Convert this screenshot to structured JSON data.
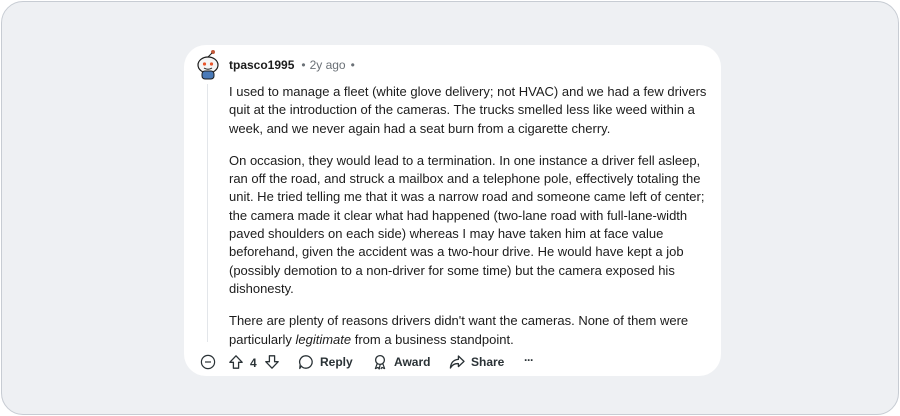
{
  "comment": {
    "username": "tpasco1995",
    "separator": "•",
    "age": "2y ago",
    "separator_end": "•",
    "paragraphs": [
      "I used to manage a fleet (white glove delivery; not HVAC) and we had a few drivers quit at the introduction of the cameras. The trucks smelled less like weed within a week, and we never again had a seat burn from a cigarette cherry.",
      "On occasion, they would lead to a termination. In one instance a driver fell asleep, ran off the road, and struck a mailbox and a telephone pole, effectively totaling the unit. He tried telling me that it was a narrow road and someone came left of center; the camera made it clear what had happened (two-lane road with full-lane-width paved shoulders on each side) whereas I may have taken him at face value beforehand, given the accident was a two-hour drive. He would have kept a job (possibly demotion to a non-driver for some time) but the camera exposed his dishonesty."
    ],
    "last_paragraph": {
      "before": "There are plenty of reasons drivers didn't want the cameras. None of them were particularly ",
      "emphasis": "legitimate",
      "after": " from a business standpoint."
    }
  },
  "actions": {
    "score": "4",
    "reply_label": "Reply",
    "award_label": "Award",
    "share_label": "Share",
    "more_label": "···"
  },
  "icons": {
    "avatar": "snoo-avatar-icon",
    "collapse": "collapse-minus-icon",
    "upvote": "upvote-arrow-icon",
    "downvote": "downvote-arrow-icon",
    "reply": "speech-bubble-icon",
    "award": "award-ribbon-icon",
    "share": "share-arrow-icon"
  },
  "colors": {
    "page_background": "#eef0f3",
    "card_background": "#ffffff",
    "text": "#1c1c1c",
    "muted_text": "#6b7177",
    "action_text": "#2a3236"
  }
}
